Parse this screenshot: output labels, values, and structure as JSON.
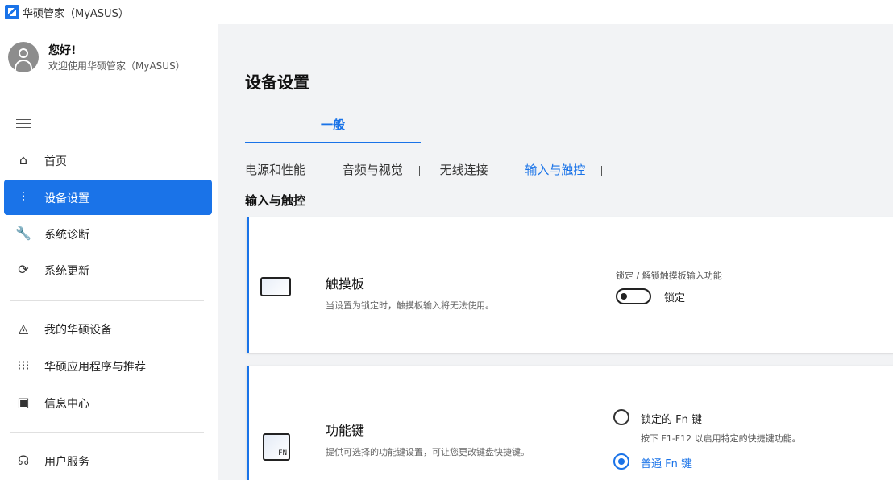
{
  "app": {
    "title": "华硕管家（MyASUS）"
  },
  "user": {
    "greeting": "您好!",
    "welcome": "欢迎使用华硕管家（MyASUS）"
  },
  "sidebar": {
    "items": [
      {
        "label": "首页",
        "icon": "home-icon"
      },
      {
        "label": "设备设置",
        "icon": "sliders-icon",
        "active": true
      },
      {
        "label": "系统诊断",
        "icon": "wrench-icon"
      },
      {
        "label": "系统更新",
        "icon": "update-icon"
      },
      {
        "label": "我的华硕设备",
        "icon": "devices-icon"
      },
      {
        "label": "华硕应用程序与推荐",
        "icon": "grid-icon"
      },
      {
        "label": "信息中心",
        "icon": "message-icon"
      },
      {
        "label": "用户服务",
        "icon": "headset-icon"
      }
    ]
  },
  "main": {
    "title": "设备设置",
    "tab": "一般",
    "subtabs": [
      "电源和性能",
      "音频与视觉",
      "无线连接",
      "输入与触控"
    ],
    "active_subtab": "输入与触控",
    "section_title": "输入与触控"
  },
  "touchpad": {
    "title": "触摸板",
    "description": "当设置为锁定时，触摸板输入将无法使用。",
    "lock_caption": "锁定 / 解锁触摸板输入功能",
    "toggle_label": "锁定",
    "toggle_on": false
  },
  "fnkey": {
    "title": "功能键",
    "description": "提供可选择的功能键设置，可让您更改键盘快捷键。",
    "icon_text": "FN",
    "option1_label": "锁定的 Fn 键",
    "option1_desc": "按下 F1-F12 以启用特定的快捷键功能。",
    "option2_label": "普通 Fn 键",
    "selected": "普通 Fn 键"
  },
  "colors": {
    "accent": "#1a73e8",
    "background": "#f2f3f5"
  }
}
